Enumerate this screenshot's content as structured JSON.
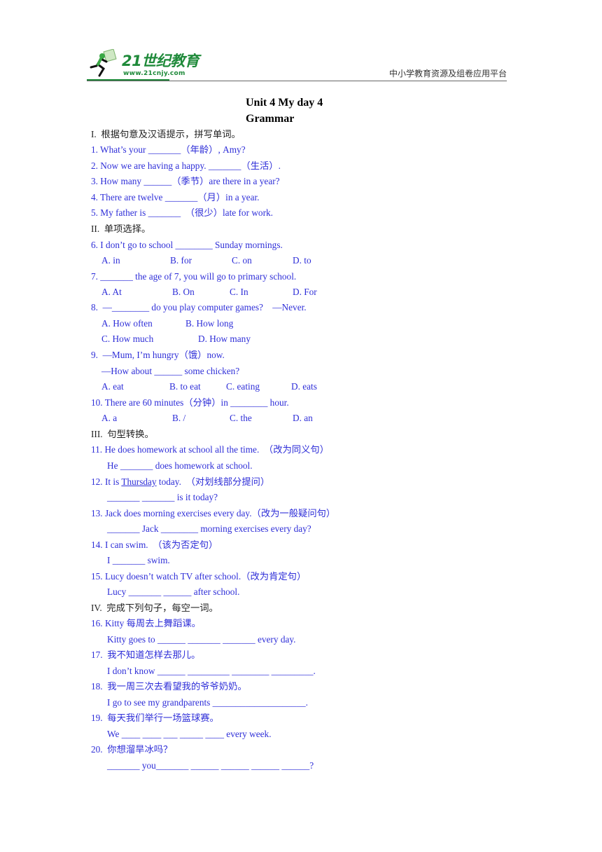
{
  "header": {
    "logo_text": "21世纪教育",
    "logo_url": "www.21cnjy.com",
    "platform": "中小学教育资源及组卷应用平台",
    "brand_color": "#1f8a3a"
  },
  "doc": {
    "title": "Unit 4 My day 4",
    "subtitle": "Grammar",
    "text_color": "#2e2ed8"
  },
  "sections": {
    "s1": "I.  根据句意及汉语提示，拼写单词。",
    "s2": "II.  单项选择。",
    "s3": "III.  句型转换。",
    "s4": "IV.  完成下列句子，每空一词。"
  },
  "q": {
    "q1": "1. What’s your _______（年龄）, Amy?",
    "q2": "2. Now we are having a happy. _______（生活）.",
    "q3": "3. How many ______（季节）are there in a year?",
    "q4": "4. There are twelve _______（月）in a year.",
    "q5": "5. My father is _______  （很少）late for work.",
    "q6": "6. I don’t go to school ________ Sunday mornings.",
    "q6_opts": [
      "A. in",
      "B. for",
      "C. on",
      "D. to"
    ],
    "q7": "7. _______ the age of 7, you will go to primary school.",
    "q7_opts": [
      "A. At",
      "B. On",
      "C. In",
      "D. For"
    ],
    "q8": "8.  —________ do you play computer games?    —Never.",
    "q8_opts": [
      "A. How often",
      "B. How long",
      "C. How much",
      "D. How many"
    ],
    "q9": "9.  —Mum, I’m hungry（饿）now.",
    "q9_b": "—How about ______ some chicken?",
    "q9_opts": [
      "A. eat",
      "B. to eat",
      "C. eating",
      "D. eats"
    ],
    "q10": "10. There are 60 minutes（分钟）in ________ hour.",
    "q10_opts": [
      "A. a",
      "B. /",
      "C. the",
      "D. an"
    ],
    "q11": "11. He does homework at school all the time.  （改为同义句）",
    "q11_b": "He _______ does homework at school.",
    "q12_pre": "12. It is ",
    "q12_ul": "Thursday",
    "q12_post": " today.  （对划线部分提问）",
    "q12_b": "_______ _______ is it today?",
    "q13": "13. Jack does morning exercises every day.（改为一般疑问句）",
    "q13_b": "_______ Jack ________ morning exercises every day?",
    "q14": "14. I can swim.  （该为否定句）",
    "q14_b": "I _______ swim.",
    "q15": "15. Lucy doesn’t watch TV after school.（改为肯定句）",
    "q15_b": "Lucy _______ ______ after school.",
    "q16": "16. Kitty 每周去上舞蹈课。",
    "q16_b": "Kitty goes to ______ _______ _______ every day.",
    "q17": "17.  我不知道怎样去那儿。",
    "q17_b": "I don’t know ______ _________ ________ _________.",
    "q18": "18.  我一周三次去看望我的爷爷奶奶。",
    "q18_b": "I go to see my grandparents ____________________.",
    "q19": "19.  每天我们举行一场篮球赛。",
    "q19_b": "We ____ ____ ___ _____ ____ every week.",
    "q20": "20.  你想溜旱冰吗？",
    "q20_b": "_______ you_______ ______ ______ ______ ______?"
  }
}
